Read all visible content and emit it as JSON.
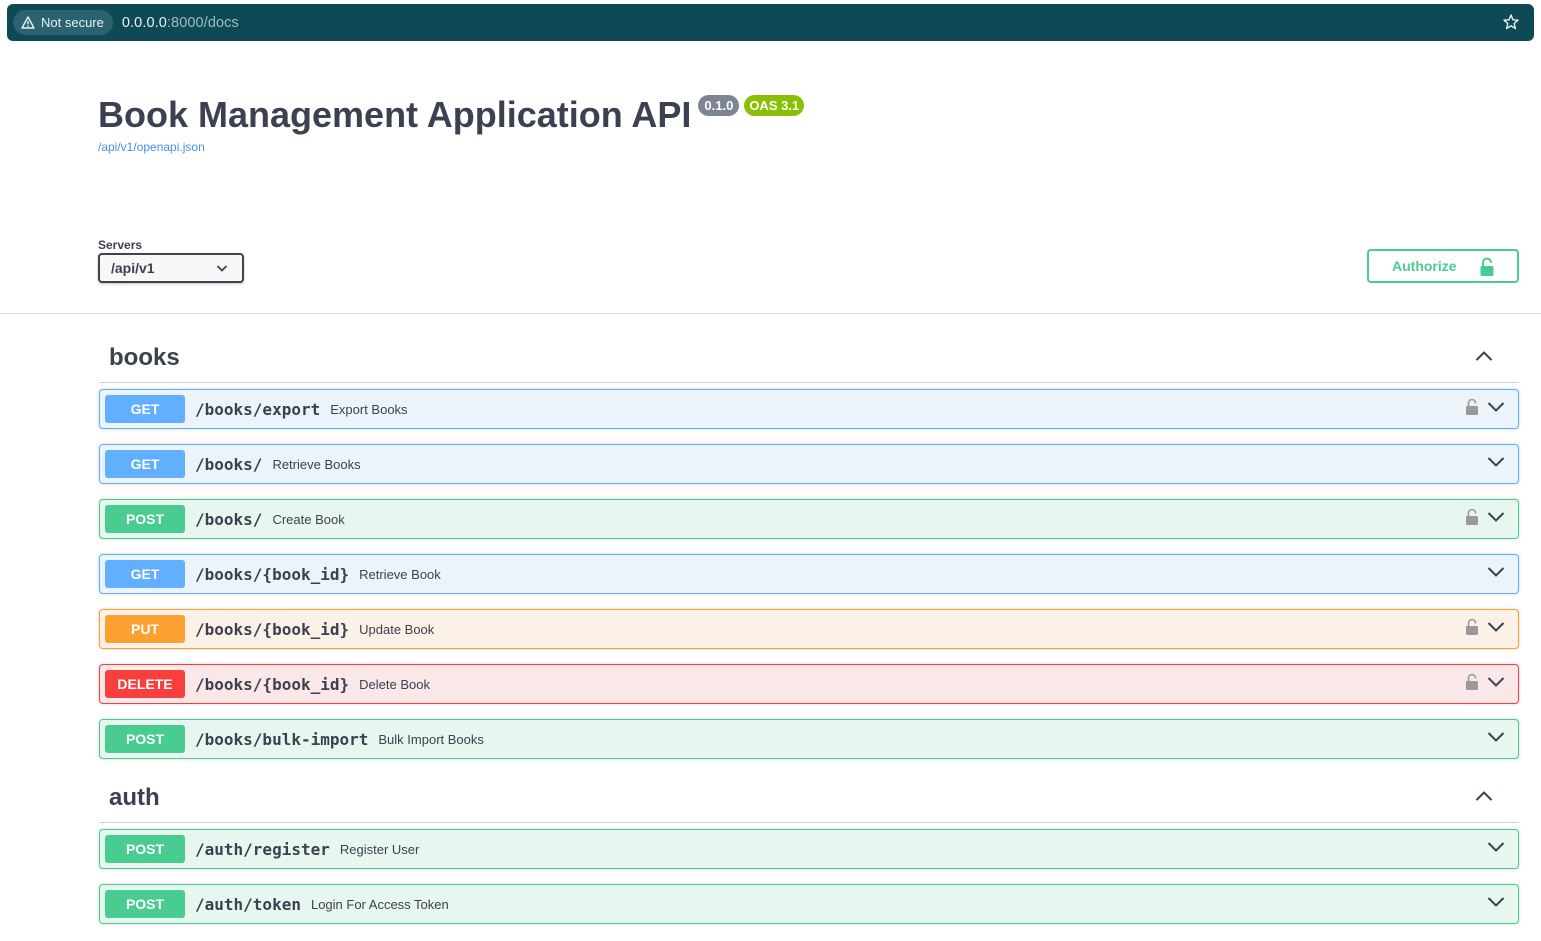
{
  "browser": {
    "security_label": "Not secure",
    "url_host": "0.0.0.0",
    "url_rest": ":8000/docs"
  },
  "info": {
    "title": "Book Management Application API",
    "version": "0.1.0",
    "oas_version": "OAS 3.1",
    "spec_url": "/api/v1/openapi.json"
  },
  "servers": {
    "label": "Servers",
    "selected": "/api/v1"
  },
  "authorize": {
    "label": "Authorize"
  },
  "tags": [
    {
      "name": "books",
      "operations": [
        {
          "method": "GET",
          "path": "/books/export",
          "summary": "Export Books",
          "locked": true
        },
        {
          "method": "GET",
          "path": "/books/",
          "summary": "Retrieve Books",
          "locked": false
        },
        {
          "method": "POST",
          "path": "/books/",
          "summary": "Create Book",
          "locked": true
        },
        {
          "method": "GET",
          "path": "/books/{book_id}",
          "summary": "Retrieve Book",
          "locked": false
        },
        {
          "method": "PUT",
          "path": "/books/{book_id}",
          "summary": "Update Book",
          "locked": true
        },
        {
          "method": "DELETE",
          "path": "/books/{book_id}",
          "summary": "Delete Book",
          "locked": true
        },
        {
          "method": "POST",
          "path": "/books/bulk-import",
          "summary": "Bulk Import Books",
          "locked": false
        }
      ]
    },
    {
      "name": "auth",
      "operations": [
        {
          "method": "POST",
          "path": "/auth/register",
          "summary": "Register User",
          "locked": false
        },
        {
          "method": "POST",
          "path": "/auth/token",
          "summary": "Login For Access Token",
          "locked": false
        }
      ]
    }
  ]
}
